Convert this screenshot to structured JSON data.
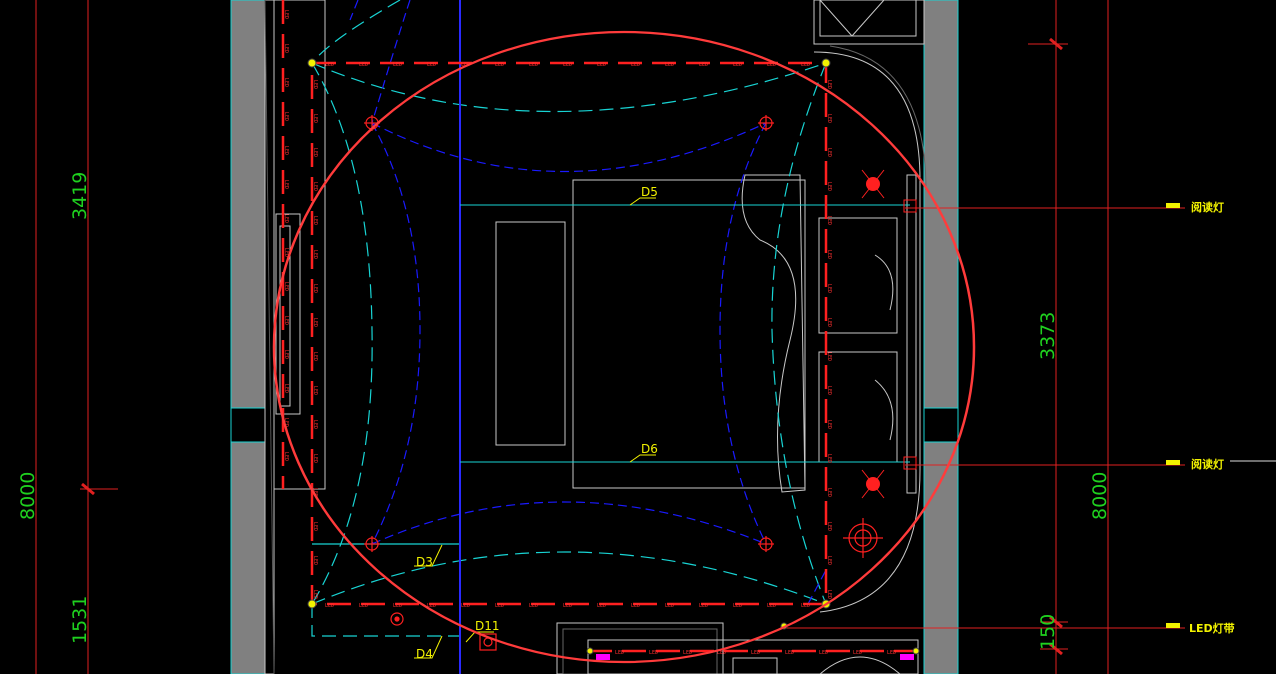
{
  "dimensions": {
    "left_top": "3419",
    "left_total": "8000",
    "left_bottom": "1531",
    "right_mid": "3373",
    "right_total": "8000",
    "right_bottom": "150"
  },
  "fixture_labels": {
    "d3": "D3",
    "d4": "D4",
    "d5": "D5",
    "d6": "D6",
    "d11": "D11"
  },
  "annotations": {
    "reading_lamp_top": "阅读灯",
    "reading_lamp_bottom": "阅读灯",
    "led_strip": "LED灯带"
  },
  "led_strip_mark": "LED",
  "colors": {
    "background": "#000000",
    "dimension_text": "#1fd11f",
    "led_strip": "#ff2020",
    "highlight_circle": "#ff3b3b",
    "cyan_lines": "#18d4d4",
    "blue_lines": "#1a1aff",
    "label_text": "#f2f200",
    "wall_fill": "#808080"
  }
}
